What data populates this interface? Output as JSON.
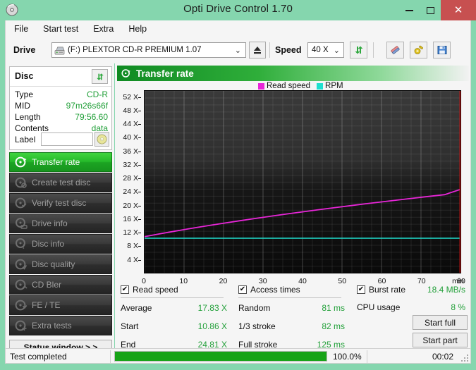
{
  "window": {
    "title": "Opti Drive Control 1.70",
    "icon": "disc-icon",
    "minimize_label": "–",
    "maximize_label": "□",
    "close_label": "✕"
  },
  "menu": {
    "items": [
      {
        "label": "File"
      },
      {
        "label": "Start test"
      },
      {
        "label": "Extra"
      },
      {
        "label": "Help"
      }
    ]
  },
  "toolbar": {
    "drive_label": "Drive",
    "drive_value": "(F:)  PLEXTOR CD-R  PREMIUM 1.07",
    "drive_arrow": "⌄",
    "eject_icon": "eject-icon",
    "speed_label": "Speed",
    "speed_value": "40 X",
    "speed_arrow": "⌄",
    "refresh_icon": "refresh-arrows-icon",
    "erase_icon": "eraser-icon",
    "tools_icon": "tools-icon",
    "save_icon": "floppy-save-icon"
  },
  "disc_panel": {
    "title": "Disc",
    "refresh_icon": "refresh-arrows-icon",
    "rows": [
      {
        "key": "Type",
        "value": "CD-R"
      },
      {
        "key": "MID",
        "value": "97m26s66f"
      },
      {
        "key": "Length",
        "value": "79:56.60"
      },
      {
        "key": "Contents",
        "value": "data"
      }
    ],
    "label_key": "Label",
    "label_value": "",
    "label_placeholder": "",
    "label_disc_icon": "cd-disc-icon"
  },
  "sidebar": {
    "items": [
      {
        "label": "Transfer rate",
        "icon": "disc-play-icon",
        "active": true
      },
      {
        "label": "Create test disc",
        "icon": "disc-write-icon",
        "active": false
      },
      {
        "label": "Verify test disc",
        "icon": "disc-check-icon",
        "active": false
      },
      {
        "label": "Drive info",
        "icon": "drive-info-icon",
        "active": false
      },
      {
        "label": "Disc info",
        "icon": "disc-info-icon",
        "active": false
      },
      {
        "label": "Disc quality",
        "icon": "disc-quality-icon",
        "active": false
      },
      {
        "label": "CD Bler",
        "icon": "disc-bler-icon",
        "active": false
      },
      {
        "label": "FE / TE",
        "icon": "disc-fete-icon",
        "active": false
      },
      {
        "label": "Extra tests",
        "icon": "disc-extra-icon",
        "active": false
      }
    ],
    "status_window_label": "Status window > >"
  },
  "chart_header": {
    "title": "Transfer rate",
    "icon": "disc-play-icon"
  },
  "chart_data": {
    "type": "line",
    "title": "Transfer rate",
    "xlabel": "min",
    "ylabel": "X",
    "xlim": [
      0,
      80
    ],
    "ylim": [
      0,
      54
    ],
    "grid": true,
    "legend_position": "top-left",
    "xticks": [
      0,
      10,
      20,
      30,
      40,
      50,
      60,
      70,
      80
    ],
    "xtick_labels": [
      "0",
      "10",
      "20",
      "30",
      "40",
      "50",
      "60",
      "70",
      "80"
    ],
    "x_unit_label": "min",
    "yticks": [
      4,
      8,
      12,
      16,
      20,
      24,
      28,
      32,
      36,
      40,
      44,
      48,
      52
    ],
    "ytick_labels": [
      "4 X",
      "8 X",
      "12 X",
      "16 X",
      "20 X",
      "24 X",
      "28 X",
      "32 X",
      "36 X",
      "40 X",
      "44 X",
      "48 X",
      "52 X"
    ],
    "series": [
      {
        "name": "Read speed",
        "color": "#e826d8",
        "x": [
          0,
          4,
          8,
          12,
          16,
          20,
          24,
          28,
          32,
          36,
          40,
          44,
          48,
          52,
          56,
          60,
          64,
          68,
          72,
          76,
          79.9
        ],
        "values": [
          10.86,
          11.72,
          12.55,
          13.34,
          14.1,
          14.84,
          15.55,
          16.24,
          16.91,
          17.57,
          18.2,
          18.82,
          19.42,
          20.01,
          20.59,
          21.15,
          21.7,
          22.24,
          22.77,
          23.29,
          24.81
        ]
      },
      {
        "name": "RPM",
        "color": "#1fe0cf",
        "x": [
          0,
          79.9
        ],
        "values": [
          10.4,
          10.4
        ]
      }
    ],
    "end_marker": {
      "x": 79.9,
      "color": "#cc1414"
    }
  },
  "stats": {
    "read_speed": {
      "checked": true,
      "check_glyph": "✔",
      "label": "Read speed",
      "rows": [
        {
          "key": "Average",
          "value": "17.83 X"
        },
        {
          "key": "Start",
          "value": "10.86 X"
        },
        {
          "key": "End",
          "value": "24.81 X"
        }
      ]
    },
    "access_times": {
      "checked": true,
      "check_glyph": "✔",
      "label": "Access times",
      "rows": [
        {
          "key": "Random",
          "value": "81 ms"
        },
        {
          "key": "1/3 stroke",
          "value": "82 ms"
        },
        {
          "key": "Full stroke",
          "value": "125 ms"
        }
      ]
    },
    "burst_rate": {
      "checked": true,
      "check_glyph": "✔",
      "label": "Burst rate",
      "value": "18.4 MB/s",
      "rows": [
        {
          "key": "CPU usage",
          "value": "8 %"
        }
      ],
      "start_full_label": "Start full",
      "start_part_label": "Start part"
    }
  },
  "statusbar": {
    "message": "Test completed",
    "progress_percent": 100.0,
    "progress_label": "100.0%",
    "elapsed": "00:02"
  },
  "colors": {
    "window_chrome": "#85d6ae",
    "accent_green": "#23a03a",
    "read_speed": "#e826d8",
    "rpm": "#1fe0cf",
    "close_button": "#c75050",
    "progress": "#17a317"
  }
}
